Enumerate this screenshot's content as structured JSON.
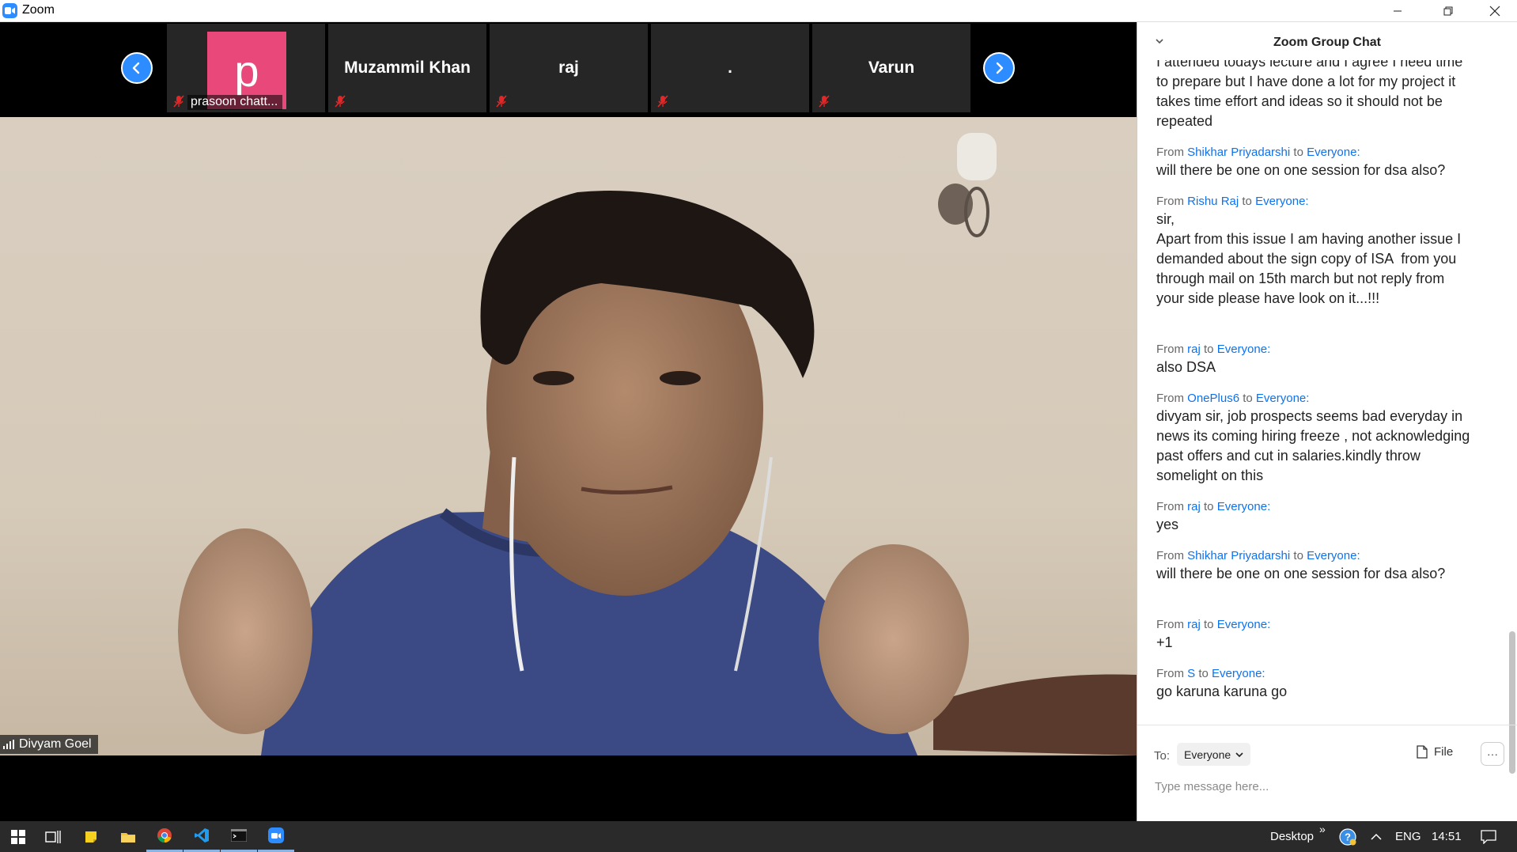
{
  "app": {
    "title": "Zoom"
  },
  "participants": [
    {
      "initial": "p",
      "label": "prasoon chatt...",
      "avatar_color": "#e8497a"
    },
    {
      "name": "Muzammil Khan"
    },
    {
      "name": "raj"
    },
    {
      "name": "."
    },
    {
      "name": "Varun"
    }
  ],
  "speaker": {
    "name": "Divyam Goel"
  },
  "chat": {
    "title": "Zoom Group Chat",
    "from_word": "From",
    "to_word": "to",
    "messages": [
      {
        "sender": "",
        "recipient": "",
        "body": "I attended todays lecture and I agree I need time to prepare but I have done a lot for my project it takes time effort and ideas so it should not be repeated"
      },
      {
        "sender": "Shikhar Priyadarshi",
        "recipient": "Everyone:",
        "body": "will there be one on one session for dsa also?"
      },
      {
        "sender": "Rishu Raj",
        "recipient": "Everyone:",
        "body": "sir,\nApart from this issue I am having another issue I demanded about the sign copy of ISA  from you through mail on 15th march but not reply from your side please have look on it...!!!\n "
      },
      {
        "sender": "raj",
        "recipient": "Everyone:",
        "body": "also DSA"
      },
      {
        "sender": "OnePlus6",
        "recipient": "Everyone:",
        "body": "divyam sir, job prospects seems bad everyday in news its coming hiring freeze , not acknowledging past offers and cut in salaries.kindly throw somelight on this"
      },
      {
        "sender": "raj",
        "recipient": "Everyone:",
        "body": "yes"
      },
      {
        "sender": "Shikhar Priyadarshi",
        "recipient": "Everyone:",
        "body": "will there be one on one session for dsa also?\n "
      },
      {
        "sender": "raj",
        "recipient": "Everyone:",
        "body": "+1"
      },
      {
        "sender": "S",
        "recipient": "Everyone:",
        "body": "go karuna karuna go"
      }
    ],
    "to_label": "To:",
    "to_value": "Everyone",
    "file_label": "File",
    "input_placeholder": "Type message here..."
  },
  "taskbar": {
    "desktop_label": "Desktop",
    "language": "ENG",
    "time": "14:51",
    "overflow": "»"
  },
  "colors": {
    "accent": "#2d8cff",
    "link": "#0e72ed",
    "avatar": "#e8497a",
    "taskbar": "#2a2a2a"
  }
}
